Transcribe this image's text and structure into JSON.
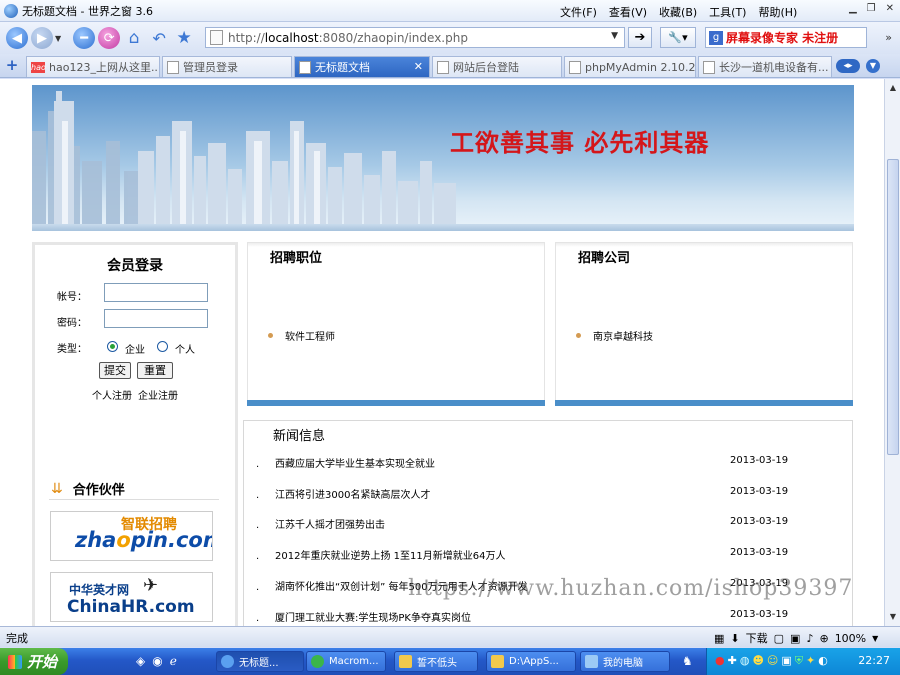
{
  "window": {
    "title": "无标题文档 - 世界之窗 3.6",
    "menu": [
      "文件(F)",
      "查看(V)",
      "收藏(B)",
      "工具(T)",
      "帮助(H)"
    ]
  },
  "address": {
    "url_prefix": "http://",
    "url_host": "localhost",
    "url_rest": ":8080/zhaopin/index.php"
  },
  "search": {
    "placeholder": "屏幕录像专家  未注册"
  },
  "tabs": [
    {
      "label": "hao123_上网从这里..."
    },
    {
      "label": "管理员登录"
    },
    {
      "label": "无标题文档"
    },
    {
      "label": "网站后台登陆"
    },
    {
      "label": "phpMyAdmin 2.10.2..."
    },
    {
      "label": "长沙一道机电设备有..."
    }
  ],
  "banner": {
    "slogan": "工欲善其事  必先利其器"
  },
  "login": {
    "title": "会员登录",
    "account_label": "帐号：",
    "password_label": "密码：",
    "type_label": "类型：",
    "type_options": [
      "企业",
      "个人"
    ],
    "submit": "提交",
    "reset": "重置",
    "register_personal": "个人注册",
    "register_company": "企业注册"
  },
  "partners": {
    "title": "合作伙伴",
    "zhaopin_sub": "智联招聘",
    "zhaopin_main_a": "zha",
    "zhaopin_main_o": "o",
    "zhaopin_main_b": "pin.com",
    "chinahr_sub": "中华英才网",
    "chinahr_main": "ChinaHR.com"
  },
  "jobs": {
    "title": "招聘职位",
    "items": [
      "软件工程师"
    ]
  },
  "companies": {
    "title": "招聘公司",
    "items": [
      "南京卓越科技"
    ]
  },
  "news": {
    "title": "新闻信息",
    "items": [
      {
        "headline": "西藏应届大学毕业生基本实现全就业",
        "date": "2013-03-19"
      },
      {
        "headline": "江西将引进3000名紧缺高层次人才",
        "date": "2013-03-19"
      },
      {
        "headline": "江苏千人摇才团强势出击",
        "date": "2013-03-19"
      },
      {
        "headline": "2012年重庆就业逆势上扬 1至11月新增就业64万人",
        "date": "2013-03-19"
      },
      {
        "headline": "湖南怀化推出“双创计划” 每年500万元用于人才资源开发",
        "date": "2013-03-19"
      },
      {
        "headline": "厦门理工就业大赛:学生现场PK争夺真实岗位",
        "date": "2013-03-19"
      }
    ]
  },
  "watermark": "https://www.huzhan.com/ishop39397",
  "status": {
    "text": "完成",
    "download_label": "下载",
    "zoom": "100%"
  },
  "taskbar": {
    "start": "开始",
    "tasks": [
      "无标题...",
      "Macrom...",
      "誓不低头",
      "D:\\AppS...",
      "我的电脑"
    ],
    "clock": "22:27"
  }
}
